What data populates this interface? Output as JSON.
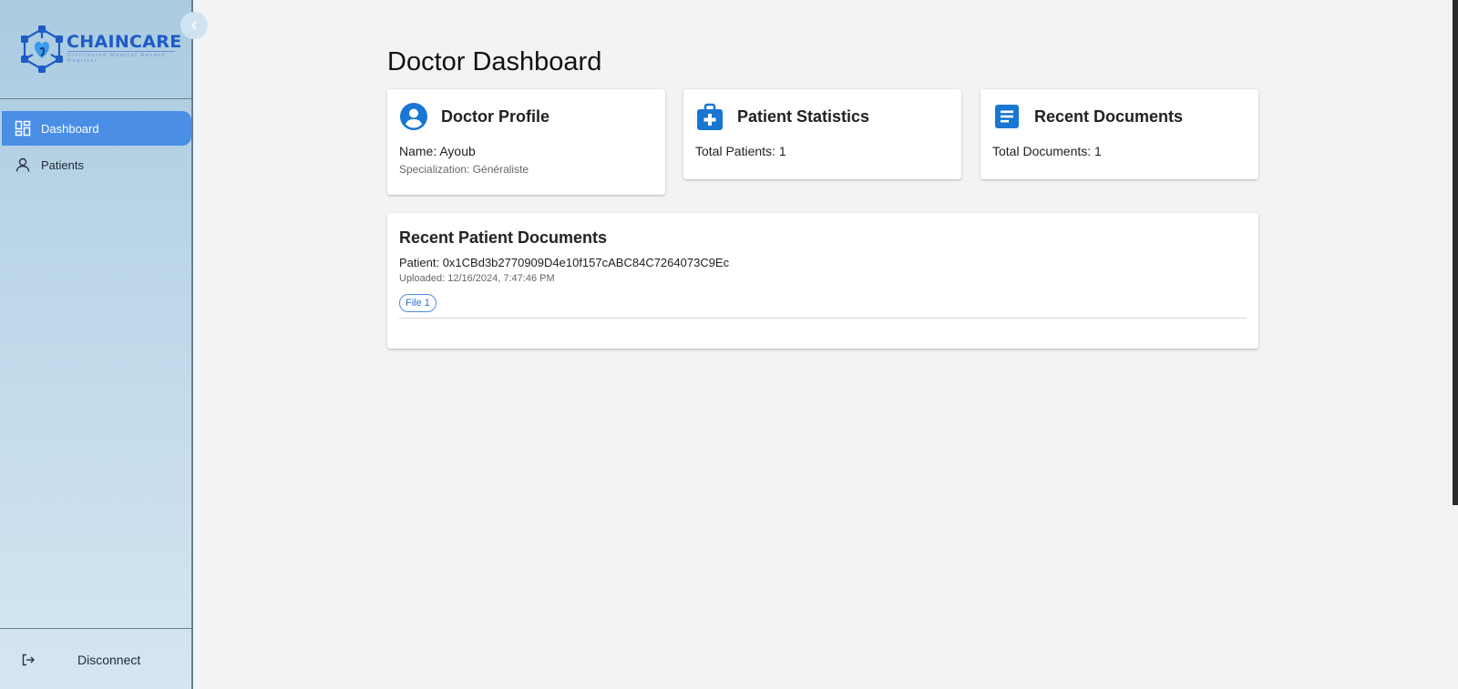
{
  "brand": {
    "name": "CHAINCARE",
    "tagline": "Distributed Medical Record Register",
    "color": "#1e5bc6"
  },
  "sidebar": {
    "collapse_icon": "chevron-left-icon",
    "items": [
      {
        "label": "Dashboard",
        "icon": "dashboard-grid-icon",
        "active": true
      },
      {
        "label": "Patients",
        "icon": "user-icon",
        "active": false
      }
    ],
    "footer": {
      "label": "Disconnect",
      "icon": "logout-icon"
    }
  },
  "main": {
    "title": "Doctor Dashboard",
    "accent": "#1976d2",
    "cards": {
      "profile": {
        "title": "Doctor Profile",
        "icon": "account-circle-icon",
        "name_line": "Name: Ayoub",
        "specialization_line": "Specialization: Généraliste"
      },
      "stats": {
        "title": "Patient Statistics",
        "icon": "medical-bag-icon",
        "line": "Total Patients: 1"
      },
      "documents": {
        "title": "Recent Documents",
        "icon": "document-icon",
        "line": "Total Documents: 1"
      }
    },
    "recent_patient_documents": {
      "title": "Recent Patient Documents",
      "entries": [
        {
          "patient": "Patient: 0x1CBd3b2770909D4e10f157cABC84C7264073C9Ec",
          "uploaded": "Uploaded: 12/16/2024, 7:47:46 PM",
          "files": [
            "File 1"
          ]
        }
      ]
    }
  }
}
